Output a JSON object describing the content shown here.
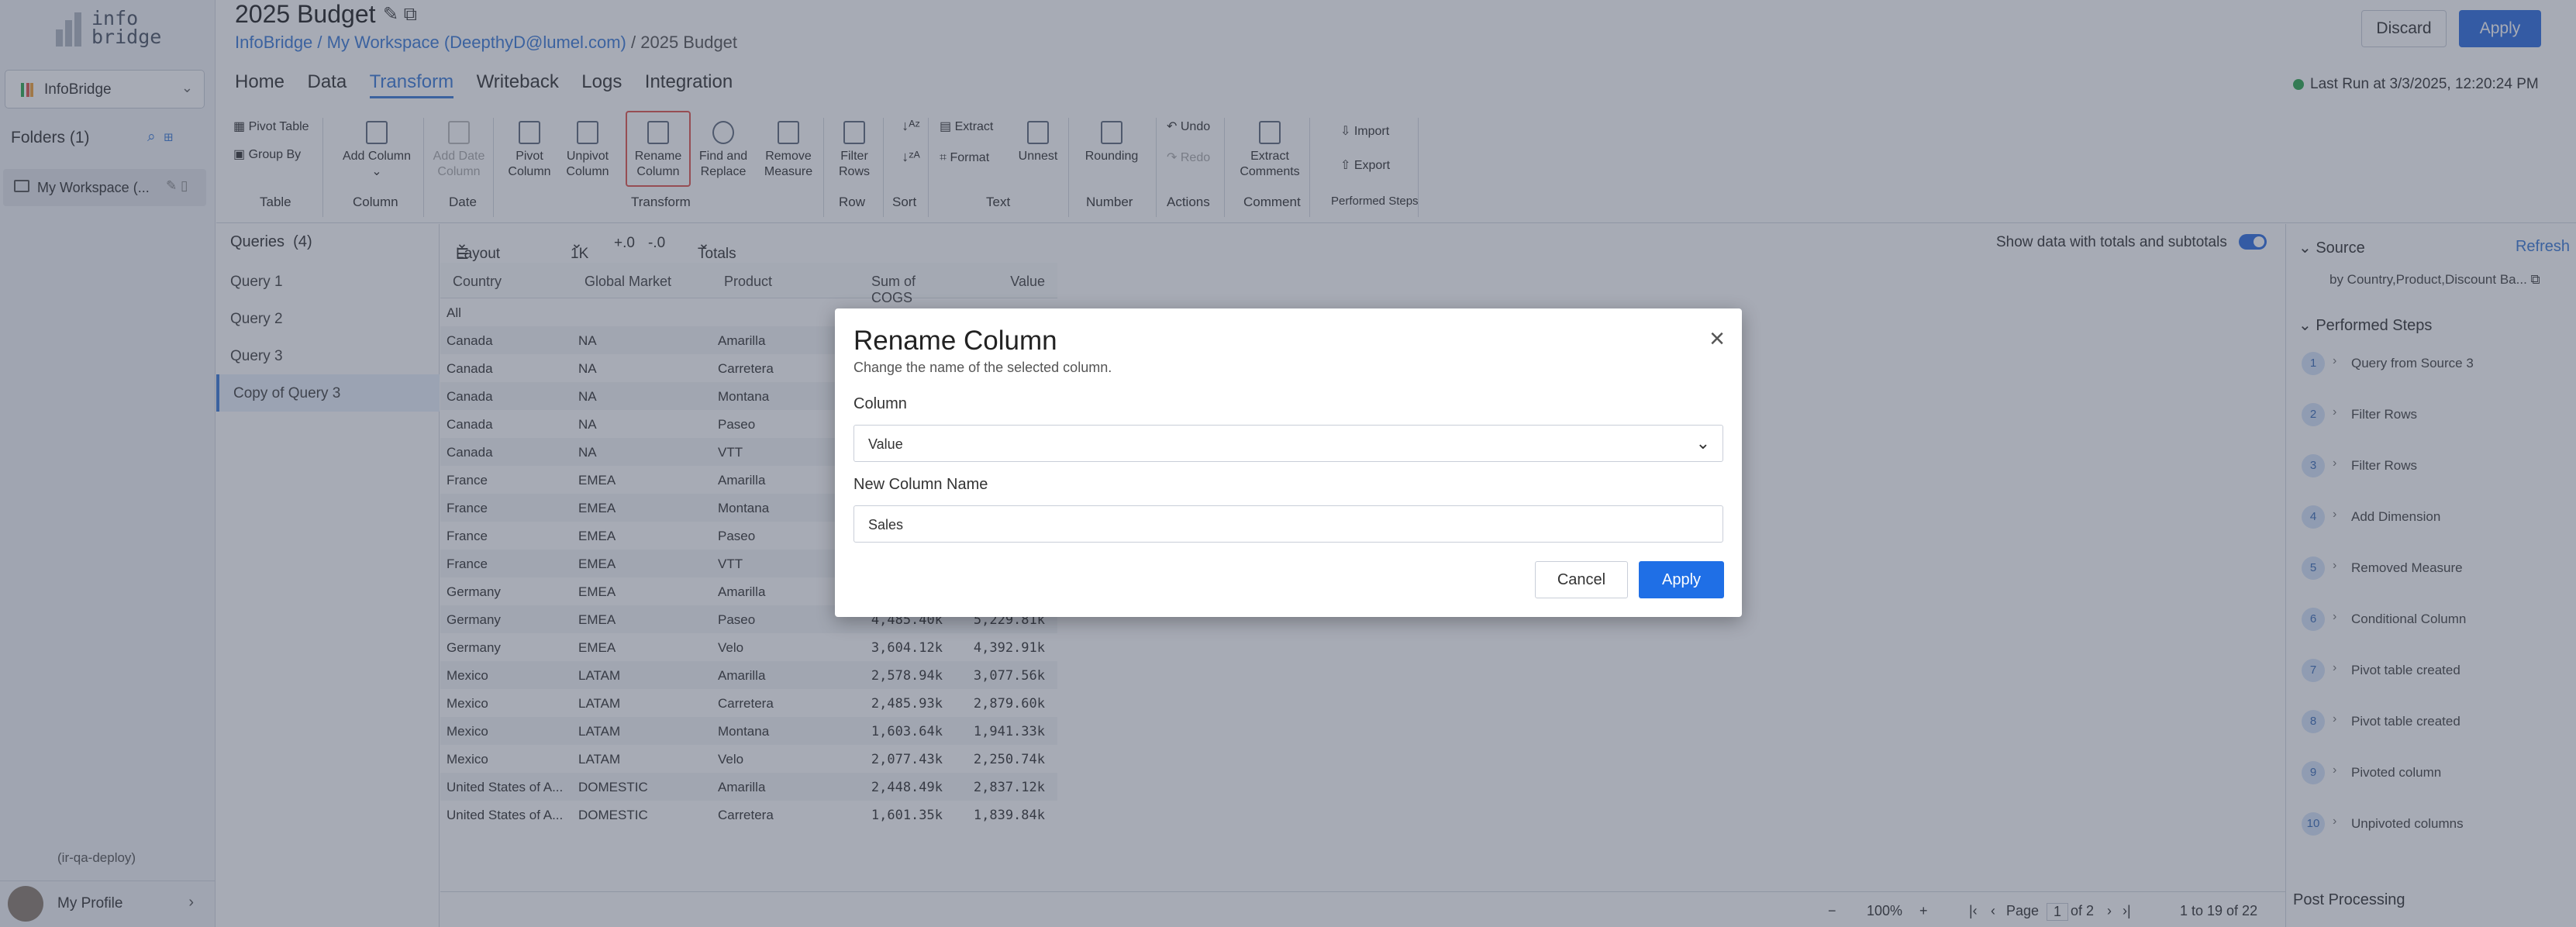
{
  "logo": {
    "line1": "info",
    "line2": "bridge"
  },
  "sidebar": {
    "workspace_select": "InfoBridge",
    "folders_label": "Folders (1)",
    "folder_item": "My Workspace (...",
    "deploy_label": "(ir-qa-deploy)",
    "profile_label": "My Profile"
  },
  "header": {
    "title": "2025 Budget",
    "breadcrumb_root": "InfoBridge",
    "breadcrumb_ws": "My Workspace (DeepthyD@lumel.com)",
    "breadcrumb_leaf": "2025 Budget",
    "discard_label": "Discard",
    "apply_label": "Apply"
  },
  "nav": {
    "tabs": [
      "Home",
      "Data",
      "Transform",
      "Writeback",
      "Logs",
      "Integration"
    ],
    "active": "Transform"
  },
  "last_run": "Last Run at 3/3/2025, 12:20:24 PM",
  "ribbon": {
    "pivot_table": "Pivot Table",
    "group_by": "Group By",
    "add_column": "Add Column",
    "add_date_column": "Add Date Column",
    "pivot_column": "Pivot Column",
    "unpivot_column": "Unpivot Column",
    "rename_column": "Rename Column",
    "find_replace": "Find and Replace",
    "remove_measure": "Remove Measure",
    "filter_rows": "Filter Rows",
    "extract": "Extract",
    "format": "Format",
    "unnest": "Unnest",
    "rounding": "Rounding",
    "undo": "Undo",
    "redo": "Redo",
    "extract_comments": "Extract Comments",
    "import": "Import",
    "export": "Export",
    "groups": [
      "Table",
      "Column",
      "Date",
      "Transform",
      "Row",
      "Sort",
      "Text",
      "Number",
      "Actions",
      "Comment",
      "Performed Steps"
    ]
  },
  "queries": {
    "header": "Queries",
    "count": "(4)",
    "items": [
      "Query 1",
      "Query 2",
      "Query 3",
      "Copy of Query 3"
    ],
    "selected_index": 3
  },
  "grid_toolbar": {
    "layout": "Layout",
    "rows": "1K",
    "totals": "Totals",
    "toggle_label": "Show data with totals and subtotals"
  },
  "grid": {
    "headers": [
      "Country",
      "Global Market",
      "Product",
      "Sum of COGS",
      "Value"
    ],
    "rows": [
      [
        "All",
        "",
        "",
        "",
        ""
      ],
      [
        "Canada",
        "NA",
        "Amarilla",
        "",
        ""
      ],
      [
        "Canada",
        "NA",
        "Carretera",
        "",
        ""
      ],
      [
        "Canada",
        "NA",
        "Montana",
        "",
        ""
      ],
      [
        "Canada",
        "NA",
        "Paseo",
        "",
        ""
      ],
      [
        "Canada",
        "NA",
        "VTT",
        "",
        ""
      ],
      [
        "France",
        "EMEA",
        "Amarilla",
        "",
        ""
      ],
      [
        "France",
        "EMEA",
        "Montana",
        "",
        ""
      ],
      [
        "France",
        "EMEA",
        "Paseo",
        "",
        ""
      ],
      [
        "France",
        "EMEA",
        "VTT",
        "",
        ""
      ],
      [
        "Germany",
        "EMEA",
        "Amarilla",
        "",
        ""
      ],
      [
        "Germany",
        "EMEA",
        "Paseo",
        "4,485.40k",
        "5,229.81k"
      ],
      [
        "Germany",
        "EMEA",
        "Velo",
        "3,604.12k",
        "4,392.91k"
      ],
      [
        "Mexico",
        "LATAM",
        "Amarilla",
        "2,578.94k",
        "3,077.56k"
      ],
      [
        "Mexico",
        "LATAM",
        "Carretera",
        "2,485.93k",
        "2,879.60k"
      ],
      [
        "Mexico",
        "LATAM",
        "Montana",
        "1,603.64k",
        "1,941.33k"
      ],
      [
        "Mexico",
        "LATAM",
        "Velo",
        "2,077.43k",
        "2,250.74k"
      ],
      [
        "United States of A...",
        "DOMESTIC",
        "Amarilla",
        "2,448.49k",
        "2,837.12k"
      ],
      [
        "United States of A...",
        "DOMESTIC",
        "Carretera",
        "1,601.35k",
        "1,839.84k"
      ]
    ]
  },
  "footer": {
    "zoom": "100%",
    "page_label": "Page",
    "page": "1",
    "of_pages": "of 2",
    "range": "1 to 19 of 22"
  },
  "right_panel": {
    "source_label": "Source",
    "refresh_label": "Refresh",
    "source_text": "by Country,Product,Discount Ba...",
    "steps_label": "Performed Steps",
    "steps": [
      "Query from Source 3",
      "Filter Rows",
      "Filter Rows",
      "Add Dimension",
      "Removed Measure",
      "Conditional Column",
      "Pivot table created",
      "Pivot table created",
      "Pivoted column",
      "Unpivoted columns"
    ],
    "post_processing": "Post Processing"
  },
  "modal": {
    "title": "Rename Column",
    "subtitle": "Change the name of the selected column.",
    "column_label": "Column",
    "column_value": "Value",
    "new_name_label": "New Column Name",
    "new_name_value": "Sales",
    "cancel_label": "Cancel",
    "apply_label": "Apply"
  }
}
